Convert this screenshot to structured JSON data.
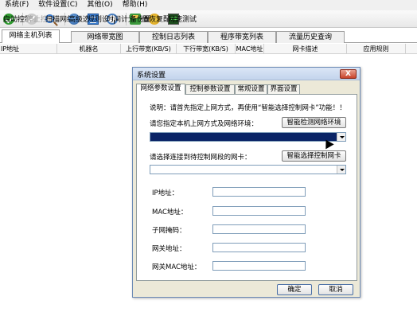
{
  "menubar": {
    "items": [
      "系统(F)",
      "软件设置(C)",
      "其他(O)",
      "帮助(H)"
    ]
  },
  "toolbar": {
    "buttons": [
      {
        "label": "启动控制",
        "icon": "start-icon",
        "enabled": true
      },
      {
        "label": "停止控制",
        "icon": "stop-icon",
        "enabled": false
      },
      {
        "label": "扫描网络",
        "icon": "scan-icon",
        "enabled": true
      },
      {
        "label": "高级选项",
        "icon": "advanced-icon",
        "enabled": true
      },
      {
        "label": "规则设置",
        "icon": "rule-icon",
        "enabled": true
      },
      {
        "label": "时间计划设置",
        "icon": "clock-icon",
        "enabled": true
      },
      {
        "label": "备份配置",
        "icon": "backup-icon",
        "enabled": true
      },
      {
        "label": "恢复配置",
        "icon": "restore-icon",
        "enabled": true
      },
      {
        "label": "网速测试",
        "icon": "nettest-icon",
        "enabled": true
      }
    ]
  },
  "main_tabs": [
    "网络主机列表",
    "网络带宽图",
    "控制日志列表",
    "程序带宽列表",
    "流量历史查询"
  ],
  "columns": [
    "IP地址",
    "机器名",
    "上行带宽(KB/S)",
    "下行带宽(KB/S)",
    "MAC地址",
    "网卡描述",
    "应用规则"
  ],
  "dialog": {
    "title": "系统设置",
    "close_label": "X",
    "tabs": [
      "网络参数设置",
      "控制参数设置",
      "常规设置",
      "界面设置"
    ],
    "description": "说明：请首先指定上网方式，再使用“智能选择控制网卡”功能！！",
    "env_label": "请您指定本机上网方式及网络环境：",
    "detect_button": "智能检测网络环境",
    "nic_label": "请选择连接到待控制网段的网卡：",
    "select_nic_button": "智能选择控制网卡",
    "fields": [
      "IP地址：",
      "MAC地址：",
      "子网掩码：",
      "网关地址：",
      "网关MAC地址："
    ],
    "ok_button": "确定",
    "cancel_button": "取消"
  }
}
